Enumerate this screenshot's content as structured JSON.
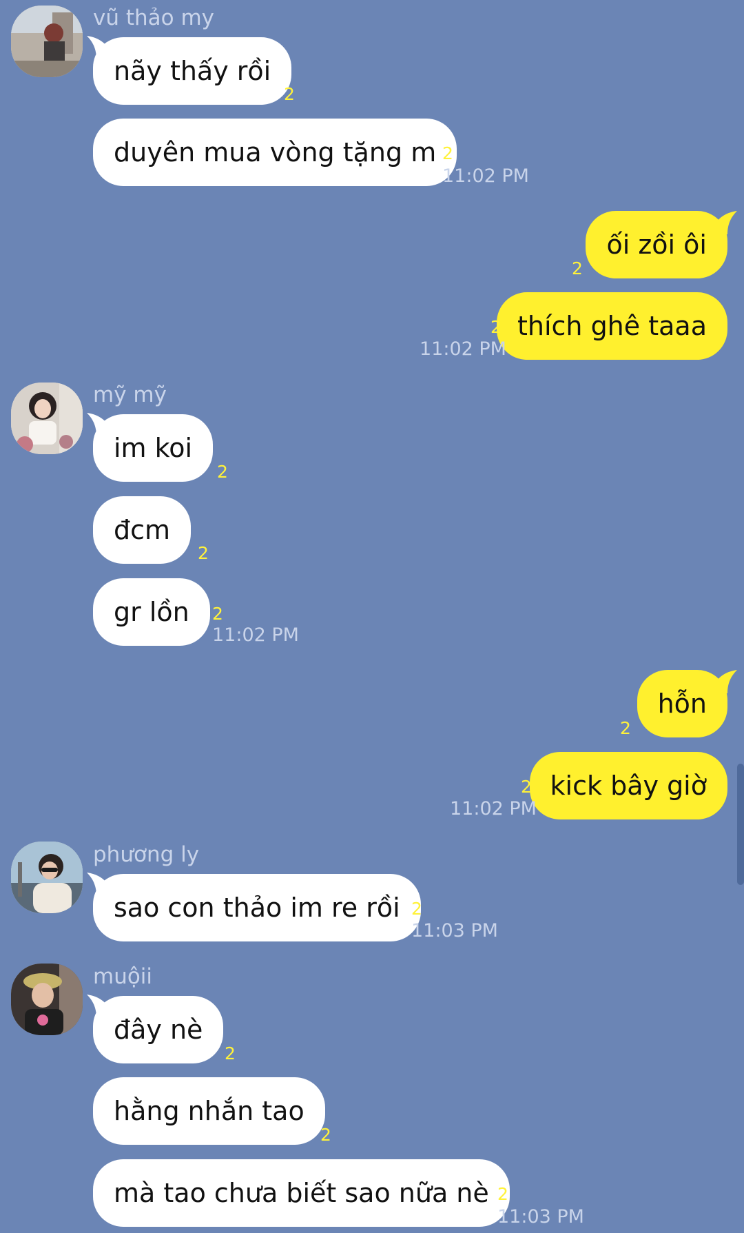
{
  "colors": {
    "background": "#6b85b5",
    "incoming_bubble": "#ffffff",
    "outgoing_bubble": "#fff02e",
    "read_count": "#fff23a",
    "meta_text": "#c9d4ea"
  },
  "messages": {
    "g1": {
      "sender": "vũ thảo my",
      "m1": "nãy thấy rồi",
      "m1_read": "2",
      "m2": "duyên mua vòng tặng m",
      "m2_read": "2",
      "time": "11:02 PM"
    },
    "g2": {
      "m1": "ối zồi ôi",
      "m1_read": "2",
      "m2": "thích ghê taaa",
      "m2_read": "2",
      "time": "11:02 PM"
    },
    "g3": {
      "sender": "mỹ mỹ",
      "m1": "im koi",
      "m1_read": "2",
      "m2": "đcm",
      "m2_read": "2",
      "m3": "gr lồn",
      "m3_read": "2",
      "time": "11:02 PM"
    },
    "g4": {
      "m1": "hỗn",
      "m1_read": "2",
      "m2": "kick bây giờ",
      "m2_read": "2",
      "time": "11:02 PM"
    },
    "g5": {
      "sender": "phương ly",
      "m1": "sao con thảo im re rồi",
      "m1_read": "2",
      "time": "11:03 PM"
    },
    "g6": {
      "sender": "muộii",
      "m1": "đây nè",
      "m1_read": "2",
      "m2": "hằng nhắn tao",
      "m2_read": "2",
      "m3": "mà tao chưa biết sao nữa nè",
      "m3_read": "2",
      "time": "11:03 PM"
    }
  }
}
